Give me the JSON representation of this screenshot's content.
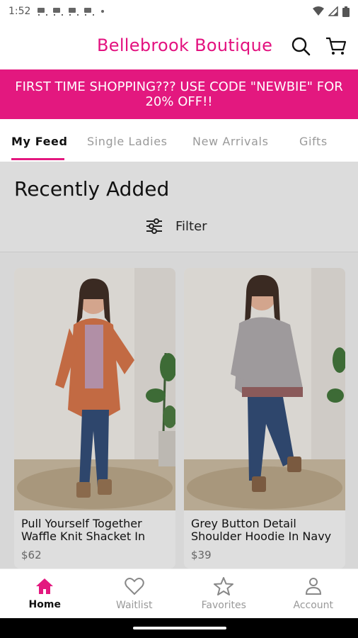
{
  "status": {
    "time": "1:52",
    "notification_icons": [
      "cart-icon",
      "cart-icon",
      "cart-icon",
      "cart-icon"
    ],
    "system_icons": [
      "wifi-icon",
      "signal-icon",
      "battery-icon"
    ]
  },
  "header": {
    "brand": "Bellebrook Boutique",
    "search_icon": "search-icon",
    "cart_icon": "cart-icon",
    "accent_color": "#e3187f"
  },
  "banner": {
    "text": "FIRST TIME SHOPPING??? USE CODE \"NEWBIE\" FOR 20% OFF!!"
  },
  "tabs": [
    {
      "label": "My Feed",
      "active": true
    },
    {
      "label": "Single Ladies",
      "active": false
    },
    {
      "label": "New Arrivals",
      "active": false
    },
    {
      "label": "Gifts",
      "active": false
    }
  ],
  "feed": {
    "title": "Recently Added",
    "filter_label": "Filter",
    "products": [
      {
        "name": "Pull Yourself Together Waffle Knit Shacket In",
        "price": "$62"
      },
      {
        "name": "Grey Button Detail Shoulder Hoodie In Navy",
        "price": "$39"
      }
    ]
  },
  "bottom_nav": [
    {
      "label": "Home",
      "icon": "home-icon",
      "active": true
    },
    {
      "label": "Waitlist",
      "icon": "heart-icon",
      "active": false
    },
    {
      "label": "Favorites",
      "icon": "star-icon",
      "active": false
    },
    {
      "label": "Account",
      "icon": "person-icon",
      "active": false
    }
  ]
}
